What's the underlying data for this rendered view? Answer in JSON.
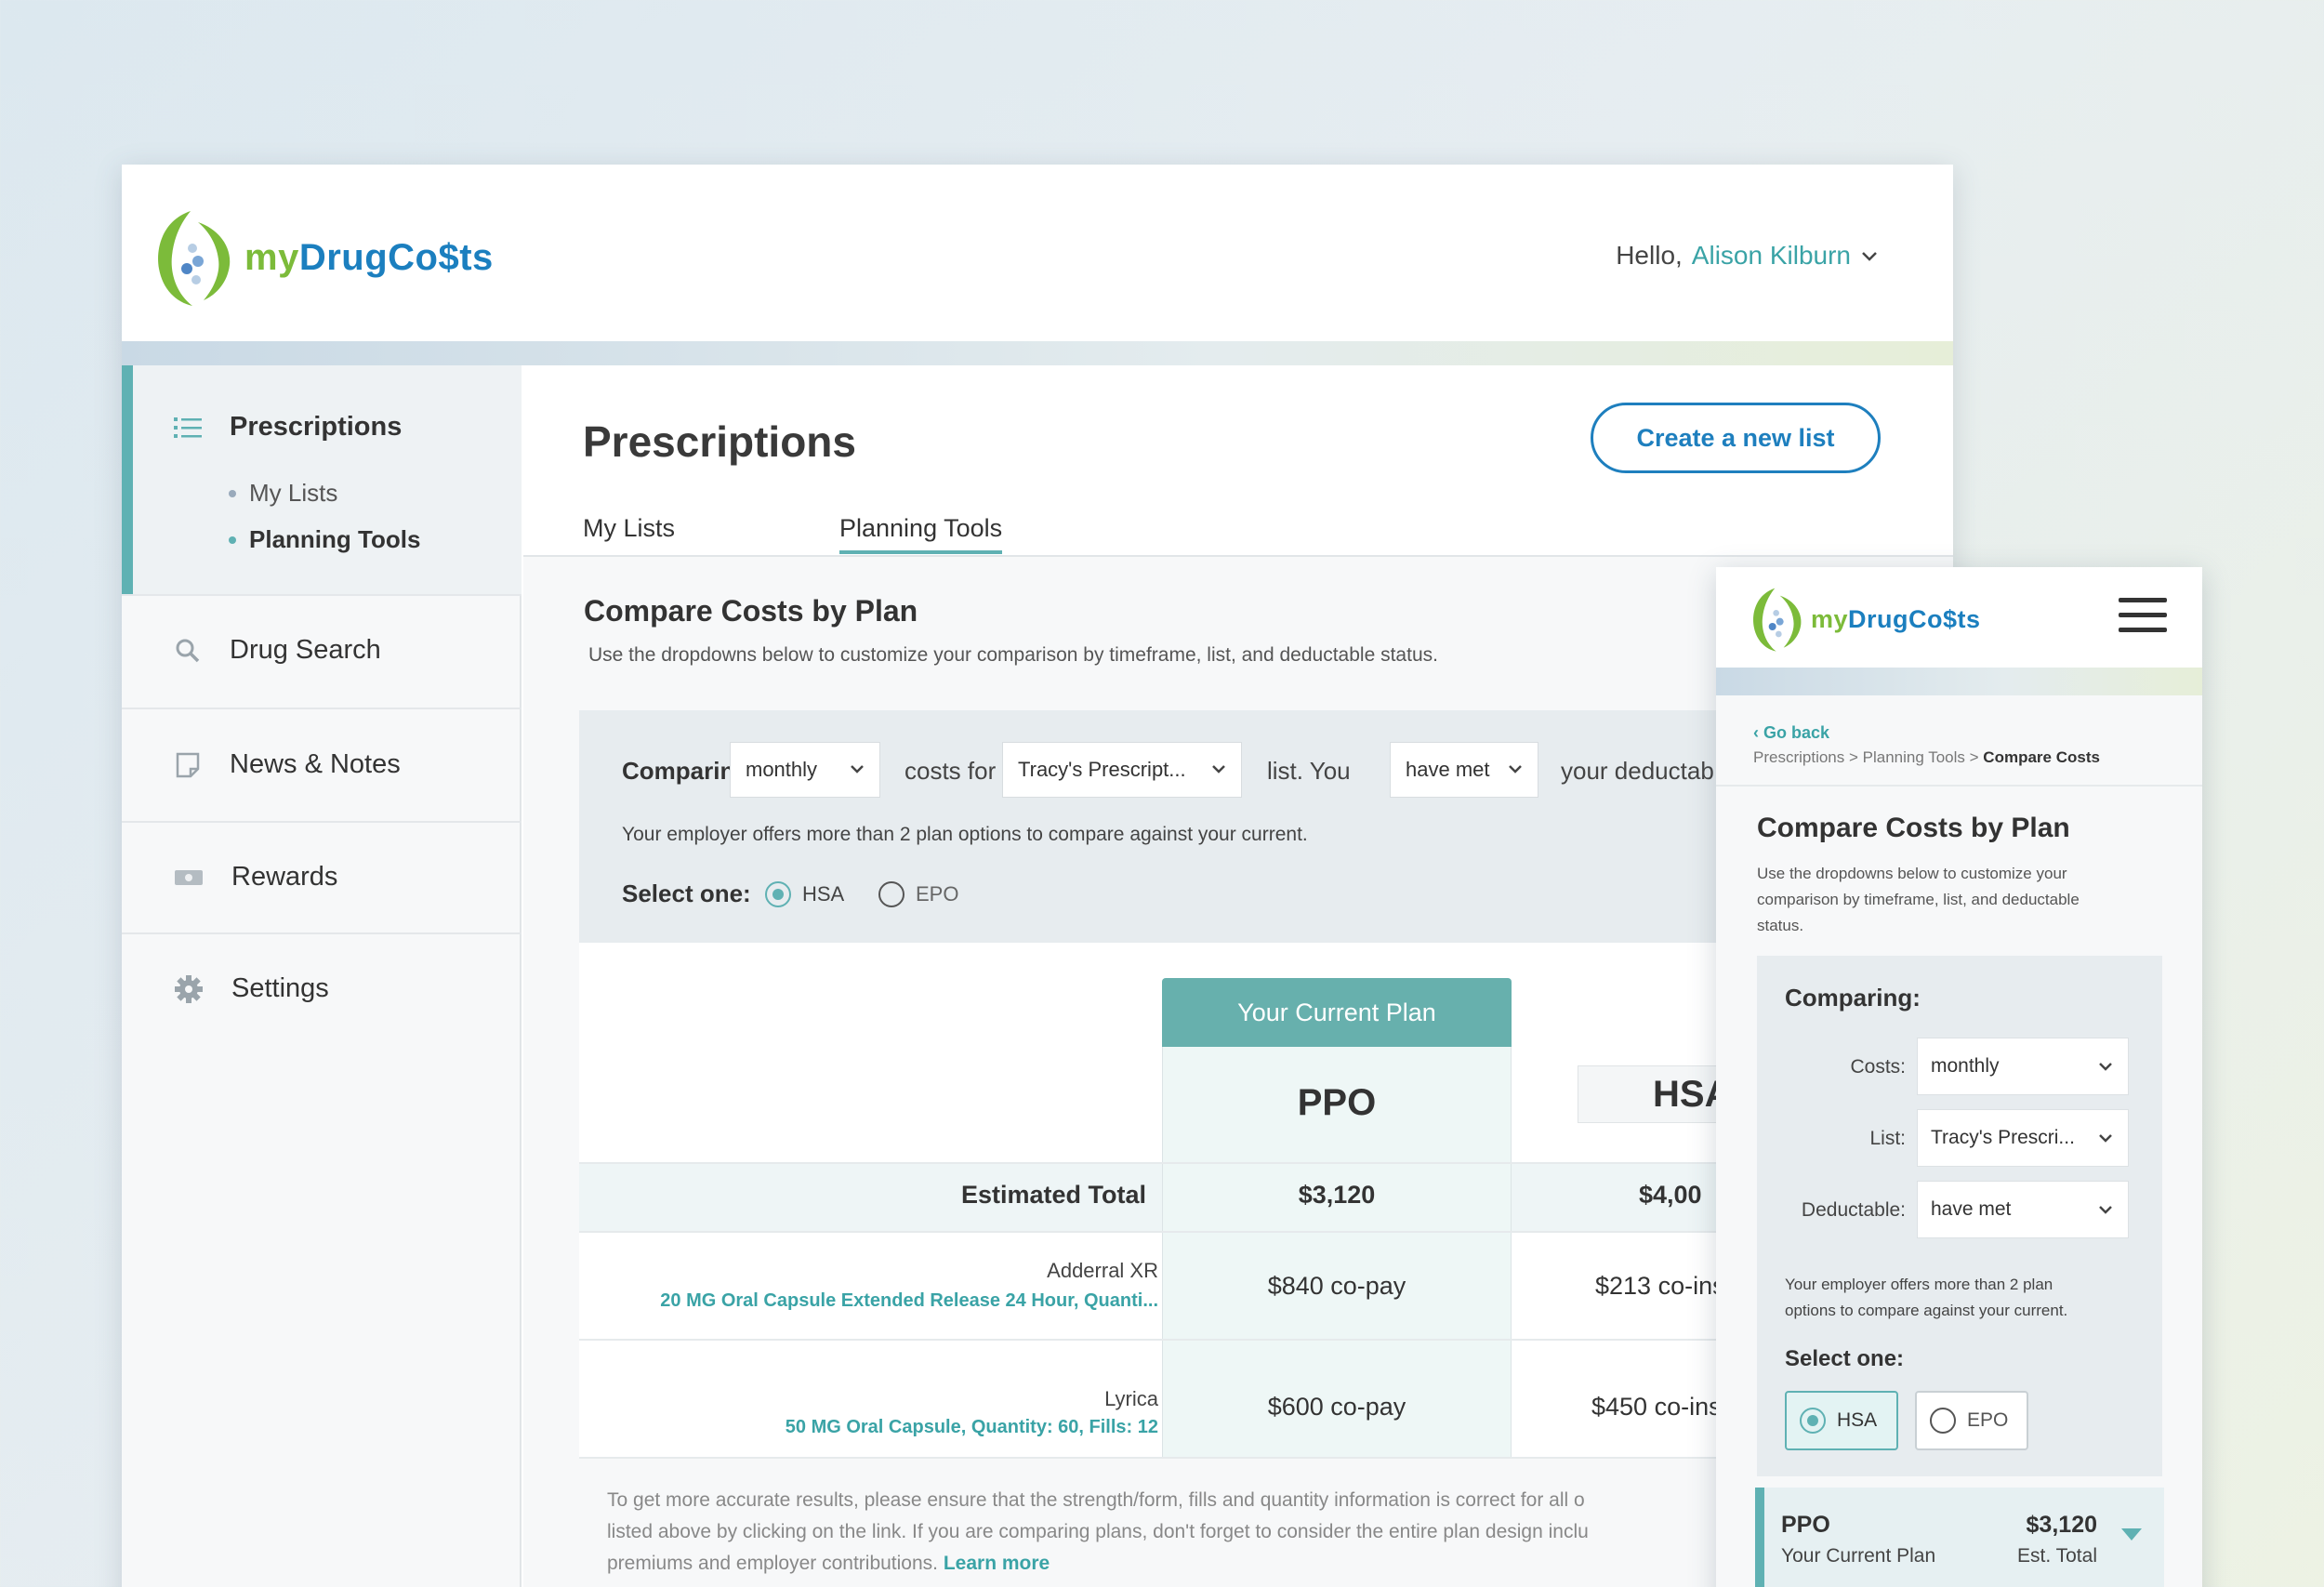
{
  "brand": {
    "logo_my": "my",
    "logo_drug": "DrugCo$ts"
  },
  "header": {
    "greeting": "Hello,",
    "user_name": "Alison Kilburn"
  },
  "sidebar": {
    "items": [
      {
        "label": "Prescriptions",
        "icon": "list-icon"
      },
      {
        "label": "Drug Search",
        "icon": "search-icon"
      },
      {
        "label": "News & Notes",
        "icon": "note-icon"
      },
      {
        "label": "Rewards",
        "icon": "cash-icon"
      },
      {
        "label": "Settings",
        "icon": "gear-icon"
      }
    ],
    "sub_items": [
      {
        "label": "My Lists"
      },
      {
        "label": "Planning Tools"
      }
    ]
  },
  "main": {
    "title": "Prescriptions",
    "create_button": "Create a new list",
    "tabs": [
      {
        "label": "My Lists"
      },
      {
        "label": "Planning Tools"
      }
    ],
    "compare": {
      "title": "Compare Costs by Plan",
      "description": "Use the dropdowns below to customize your comparison by timeframe, list, and deductable status.",
      "comparing_label": "Comparing",
      "timeframe": "monthly",
      "costs_for": "costs for",
      "list_value": "Tracy's Prescript...",
      "list_you": "list. You",
      "deductible_value": "have met",
      "your_deductable": "your deductab",
      "employer_note": "Your employer offers more than 2 plan options to compare against your current.",
      "select_one": "Select one:",
      "options": [
        "HSA",
        "EPO"
      ],
      "selected": "HSA"
    },
    "table": {
      "current_plan_label": "Your Current Plan",
      "plans": [
        "PPO",
        "HSA"
      ],
      "estimated_total_label": "Estimated Total",
      "totals": [
        "$3,120",
        "$4,00"
      ],
      "drugs": [
        {
          "name": "Adderral XR",
          "detail": "20 MG Oral Capsule Extended Release 24 Hour, Quanti...",
          "costs": [
            "$840 co-pay",
            "$213 co-ins"
          ]
        },
        {
          "name": "Lyrica",
          "detail": "50 MG Oral Capsule, Quantity: 60, Fills: 12",
          "costs": [
            "$600 co-pay",
            "$450 co-ins"
          ]
        }
      ]
    },
    "footnote": {
      "line1": "To get more accurate results, please ensure that the strength/form, fills and quantity information is correct for all o",
      "line2": "listed above by clicking on the link. If you are comparing plans, don't forget to consider the entire plan design inclu",
      "line3": "premiums and employer contributions.",
      "learn_more": "Learn more"
    }
  },
  "mobile": {
    "go_back": "‹ Go back",
    "breadcrumb": "Prescriptions > Planning Tools >",
    "breadcrumb_current": "Compare Costs",
    "title": "Compare Costs by Plan",
    "description_lines": [
      "Use the dropdowns below to customize your",
      "comparison by timeframe, list, and deductable",
      "status."
    ],
    "comparing_label": "Comparing:",
    "costs_label": "Costs:",
    "costs_value": "monthly",
    "list_label": "List:",
    "list_value": "Tracy's Prescri...",
    "deductable_label": "Deductable:",
    "deductable_value": "have met",
    "employer_note_lines": [
      "Your employer offers more than 2 plan",
      "options to compare against your current."
    ],
    "select_one": "Select one:",
    "options": [
      "HSA",
      "EPO"
    ],
    "plan_name": "PPO",
    "plan_sub": "Your Current Plan",
    "plan_total": "$3,120",
    "plan_total_label": "Est. Total"
  },
  "colors": {
    "accent": "#5fb1b3",
    "brand_blue": "#1b7fbf",
    "brand_green": "#7cbb3a",
    "current_plan_header": "#67b0ad"
  }
}
